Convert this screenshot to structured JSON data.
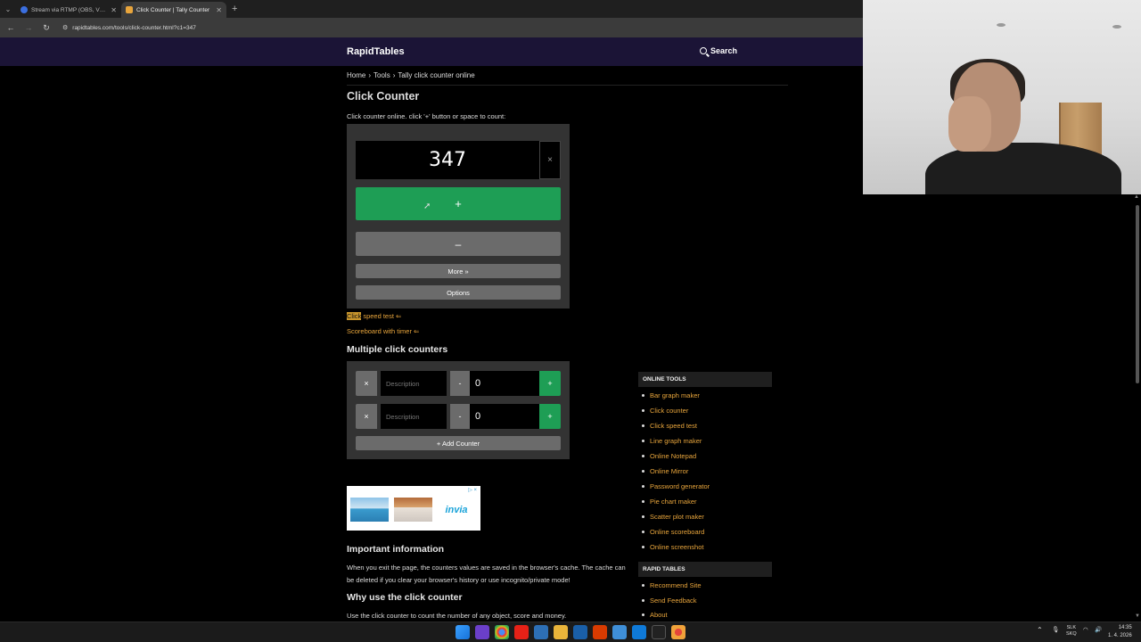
{
  "browser": {
    "tabs": [
      {
        "title": "Stream via RTMP (OBS, Vmix, Zoom…",
        "active": false,
        "favicon_color": "#3b6fe0"
      },
      {
        "title": "Click Counter | Tally Counter",
        "active": true,
        "favicon_color": "#e8a53c"
      }
    ],
    "new_tab": "+",
    "url": "rapidtables.com/tools/click-counter.html?c1=347"
  },
  "site": {
    "logo": "RapidTables",
    "search_label": "Search"
  },
  "breadcrumb": {
    "home": "Home",
    "sep1": "›",
    "tools": "Tools",
    "sep2": "›",
    "current": "Tally click counter online"
  },
  "page": {
    "title": "Click Counter",
    "intro": "Click counter online. click '+' button or space to count:"
  },
  "counter": {
    "value": "347",
    "reset": "×",
    "plus": "+",
    "minus": "–",
    "more": "More »",
    "options": "Options"
  },
  "links": {
    "click_speed_hl": "Click",
    "click_speed_rest": " speed test ⇐",
    "scoreboard": "Scoreboard with timer ⇐"
  },
  "multi": {
    "heading": "Multiple click counters",
    "rows": [
      {
        "del": "×",
        "placeholder": "Description",
        "minus": "-",
        "value": "0",
        "plus": "+"
      },
      {
        "del": "×",
        "placeholder": "Description",
        "minus": "-",
        "value": "0",
        "plus": "+"
      }
    ],
    "add": "+ Add Counter"
  },
  "ad": {
    "brand": "invia",
    "mark": "▷ ×"
  },
  "info": {
    "heading": "Important information",
    "text": "When you exit the page, the counters values are saved in the browser's cache. The cache can be deleted if you clear your browser's history or use incognito/private mode!",
    "why_heading": "Why use the click counter",
    "why_text": "Use the click counter to count the number of any object, score and money."
  },
  "sidebar": {
    "online_tools_heading": "ONLINE TOOLS",
    "online_tools": [
      "Bar graph maker",
      "Click counter",
      "Click speed test",
      "Line graph maker",
      "Online Notepad",
      "Online Mirror",
      "Password generator",
      "Pie chart maker",
      "Scatter plot maker",
      "Online scoreboard",
      "Online screenshot"
    ],
    "rapid_tables_heading": "RAPID TABLES",
    "rapid_tables": [
      "Recommend Site",
      "Send Feedback",
      "About"
    ]
  },
  "taskbar": {
    "lang_top": "SLK",
    "lang_bottom": "SKQ",
    "time": "14:35",
    "date": "1. 4. 2026",
    "icons": [
      "windows-icon",
      "visual-studio-icon",
      "chrome-icon",
      "youtube-icon",
      "monitor-icon",
      "folder-icon",
      "shield-icon",
      "office-icon",
      "notes-icon",
      "store-icon",
      "terminal-icon",
      "chrome-canary-icon"
    ]
  },
  "colors": {
    "accent_green": "#1e9e55",
    "link_orange": "#e8a53c",
    "header_purple": "#1b1436",
    "button_gray": "#6b6b6b"
  }
}
